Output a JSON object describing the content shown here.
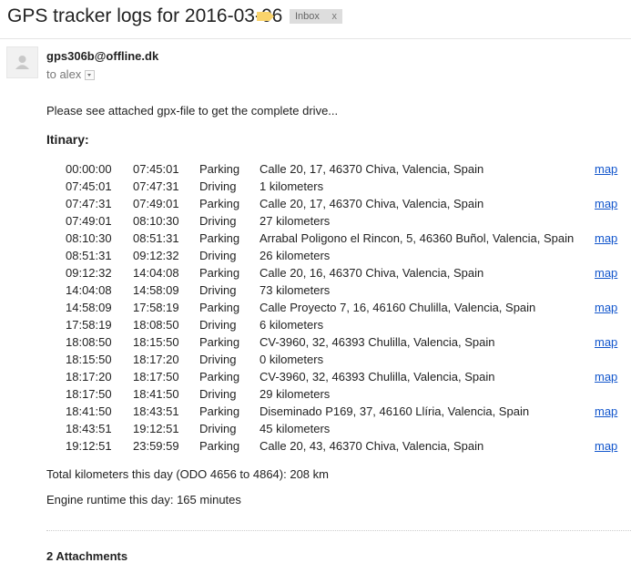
{
  "email": {
    "subject": "GPS tracker logs for 2016-03-06",
    "label_color": "#f9d36b",
    "inbox_label": "Inbox",
    "inbox_remove": "x",
    "sender": "gps306b@offline.dk",
    "to_line": "to alex",
    "intro": "Please see attached gpx-file to get the complete drive...",
    "itinary_heading": "Itinary:",
    "link_color": "#1155cc",
    "itinerary": [
      {
        "start": "00:00:00",
        "end": "07:45:01",
        "type": "Parking",
        "place": "Calle 20, 17, 46370 Chiva, Valencia, Spain",
        "map": "map"
      },
      {
        "start": "07:45:01",
        "end": "07:47:31",
        "type": "Driving",
        "place": "1 kilometers",
        "map": ""
      },
      {
        "start": "07:47:31",
        "end": "07:49:01",
        "type": "Parking",
        "place": "Calle 20, 17, 46370 Chiva, Valencia, Spain",
        "map": "map"
      },
      {
        "start": "07:49:01",
        "end": "08:10:30",
        "type": "Driving",
        "place": "27 kilometers",
        "map": ""
      },
      {
        "start": "08:10:30",
        "end": "08:51:31",
        "type": "Parking",
        "place": "Arrabal Poligono el Rincon, 5, 46360 Buñol, Valencia, Spain",
        "map": "map"
      },
      {
        "start": "08:51:31",
        "end": "09:12:32",
        "type": "Driving",
        "place": "26 kilometers",
        "map": ""
      },
      {
        "start": "09:12:32",
        "end": "14:04:08",
        "type": "Parking",
        "place": "Calle 20, 16, 46370 Chiva, Valencia, Spain",
        "map": "map"
      },
      {
        "start": "14:04:08",
        "end": "14:58:09",
        "type": "Driving",
        "place": "73 kilometers",
        "map": ""
      },
      {
        "start": "14:58:09",
        "end": "17:58:19",
        "type": "Parking",
        "place": "Calle Proyecto 7, 16, 46160 Chulilla, Valencia, Spain",
        "map": "map"
      },
      {
        "start": "17:58:19",
        "end": "18:08:50",
        "type": "Driving",
        "place": "6 kilometers",
        "map": ""
      },
      {
        "start": "18:08:50",
        "end": "18:15:50",
        "type": "Parking",
        "place": "CV-3960, 32, 46393 Chulilla, Valencia, Spain",
        "map": "map"
      },
      {
        "start": "18:15:50",
        "end": "18:17:20",
        "type": "Driving",
        "place": "0 kilometers",
        "map": ""
      },
      {
        "start": "18:17:20",
        "end": "18:17:50",
        "type": "Parking",
        "place": "CV-3960, 32, 46393 Chulilla, Valencia, Spain",
        "map": "map"
      },
      {
        "start": "18:17:50",
        "end": "18:41:50",
        "type": "Driving",
        "place": "29 kilometers",
        "map": ""
      },
      {
        "start": "18:41:50",
        "end": "18:43:51",
        "type": "Parking",
        "place": "Diseminado P169, 37, 46160 Llíria, Valencia, Spain",
        "map": "map"
      },
      {
        "start": "18:43:51",
        "end": "19:12:51",
        "type": "Driving",
        "place": "45 kilometers",
        "map": ""
      },
      {
        "start": "19:12:51",
        "end": "23:59:59",
        "type": "Parking",
        "place": "Calle 20, 43, 46370 Chiva, Valencia, Spain",
        "map": "map"
      }
    ],
    "total_km": "Total kilometers this day (ODO 4656 to 4864): 208 km",
    "engine_runtime": "Engine runtime this day: 165 minutes",
    "attachments_heading": "2 Attachments"
  }
}
